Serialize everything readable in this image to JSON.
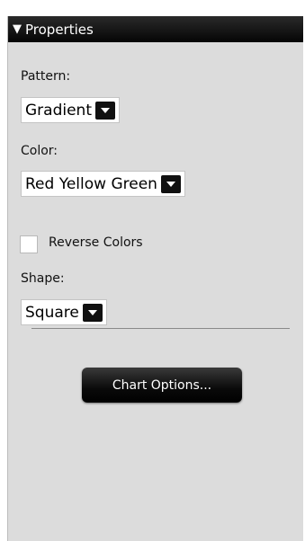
{
  "panel": {
    "title": "Properties",
    "collapse_glyph": "▼"
  },
  "pattern": {
    "label": "Pattern:",
    "value": "Gradient"
  },
  "color": {
    "label": "Color:",
    "value": "Red Yellow Green"
  },
  "reverse_colors": {
    "label": "Reverse Colors",
    "checked": false
  },
  "shape": {
    "label": "Shape:",
    "value": "Square"
  },
  "chart_options_button": {
    "label": "Chart Options..."
  },
  "icons": {
    "collapse": "triangle-down-icon",
    "dropdown": "chevron-down-icon"
  },
  "colors": {
    "panel_bg": "#dcdcdc",
    "header_bg": "#000000",
    "button_bg": "#000000"
  }
}
